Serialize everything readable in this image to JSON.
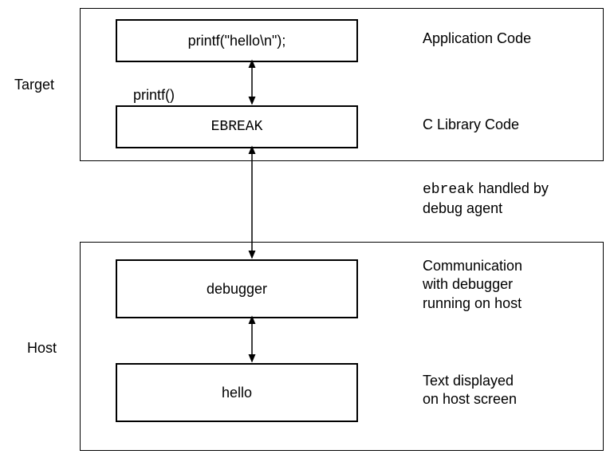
{
  "labels": {
    "target": "Target",
    "host": "Host",
    "printf_fn": "printf()"
  },
  "nodes": {
    "app": "printf(\"hello\\n\");",
    "ebreak": "EBREAK",
    "debugger": "debugger",
    "hello": "hello"
  },
  "descriptions": {
    "app": "Application Code",
    "clib": "C Library Code",
    "ebreak_handled_pre": "ebreak",
    "ebreak_handled_post": " handled by",
    "ebreak_handled_line2": "debug agent",
    "debugger": "Communication\nwith debugger\nrunning on host",
    "hello": "Text displayed\non host screen"
  }
}
